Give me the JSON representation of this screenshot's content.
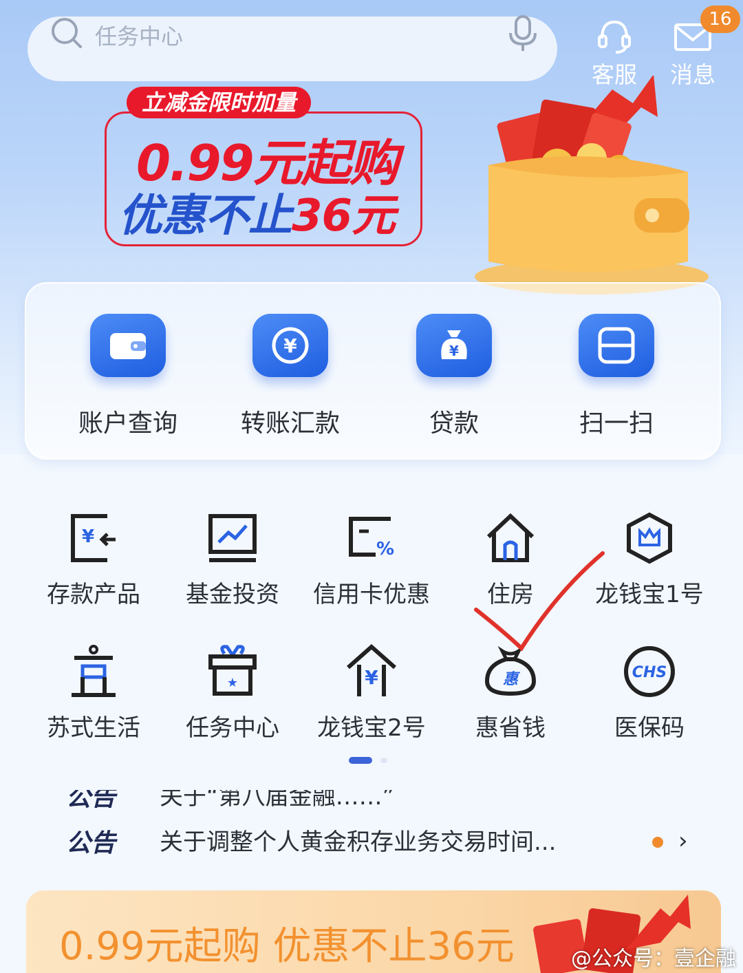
{
  "search": {
    "placeholder": "任务中心"
  },
  "header": {
    "service_label": "客服",
    "message_label": "消息",
    "message_badge": "16"
  },
  "promo": {
    "tag": "立减金限时加量",
    "line1": "0.99元起购",
    "line2_a": "优惠不止",
    "line2_b": "36元"
  },
  "quick_actions": [
    {
      "label": "账户查询",
      "icon": "wallet-icon"
    },
    {
      "label": "转账汇款",
      "icon": "yuan-transfer-icon"
    },
    {
      "label": "贷款",
      "icon": "money-bag-icon"
    },
    {
      "label": "扫一扫",
      "icon": "scan-icon"
    }
  ],
  "grid": [
    {
      "label": "存款产品",
      "icon": "deposit-icon"
    },
    {
      "label": "基金投资",
      "icon": "fund-chart-icon"
    },
    {
      "label": "信用卡优惠",
      "icon": "credit-card-discount-icon"
    },
    {
      "label": "住房",
      "icon": "house-icon"
    },
    {
      "label": "龙钱宝1号",
      "icon": "crown-hexagon-icon"
    },
    {
      "label": "苏式生活",
      "icon": "pavilion-icon"
    },
    {
      "label": "任务中心",
      "icon": "gift-box-icon"
    },
    {
      "label": "龙钱宝2号",
      "icon": "yuan-house-icon"
    },
    {
      "label": "惠省钱",
      "icon": "discount-bag-icon"
    },
    {
      "label": "医保码",
      "icon": "chs-badge-icon"
    }
  ],
  "announcements": {
    "tag": "公告",
    "item_prev": "关于“第八届金融……”",
    "item_current": "关于调整个人黄金积存业务交易时间..."
  },
  "bottom_banner": {
    "text": "0.99元起购 优惠不止36元"
  },
  "watermark": "@公众号：壹企融",
  "colors": {
    "primary_blue": "#1f5ee0",
    "promo_red": "#e8192b",
    "accent_orange": "#f08a2c",
    "annotation_red": "#e0322b"
  }
}
